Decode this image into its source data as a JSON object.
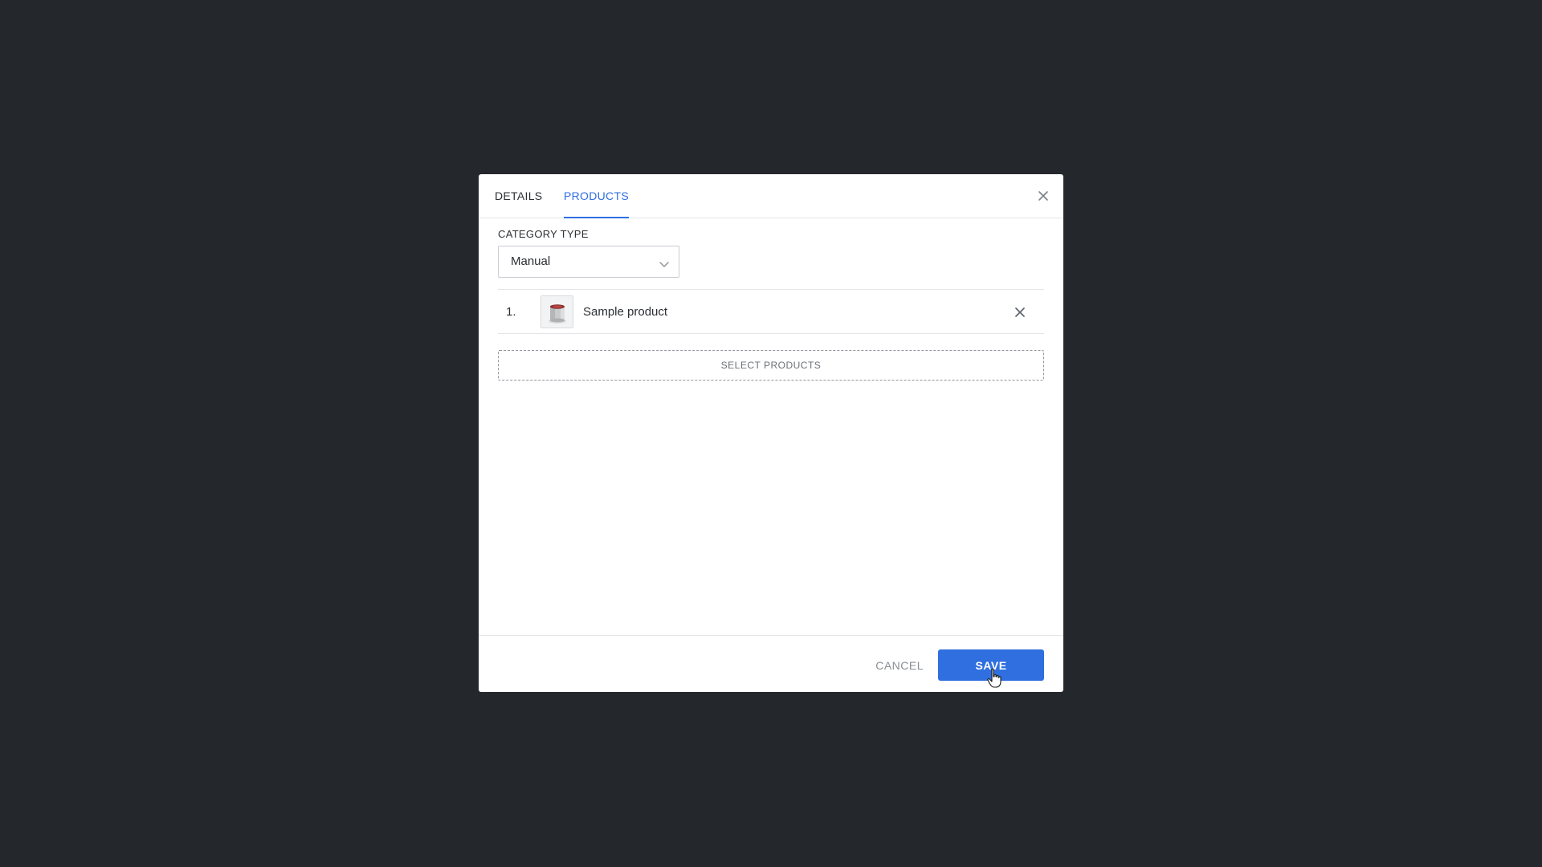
{
  "modal": {
    "tabs": [
      {
        "label": "DETAILS",
        "active": false
      },
      {
        "label": "PRODUCTS",
        "active": true
      }
    ],
    "close_icon": "close-icon"
  },
  "category_type": {
    "label": "CATEGORY TYPE",
    "selected": "Manual",
    "chevron_icon": "chevron-down-icon"
  },
  "products": [
    {
      "index": "1.",
      "name": "Sample product",
      "thumbnail": "product-thumbnail",
      "remove_icon": "close-icon"
    }
  ],
  "select_products_label": "SELECT PRODUCTS",
  "footer": {
    "cancel_label": "CANCEL",
    "save_label": "SAVE"
  },
  "colors": {
    "accent": "#2f6fe0",
    "backdrop": "#24282c"
  }
}
